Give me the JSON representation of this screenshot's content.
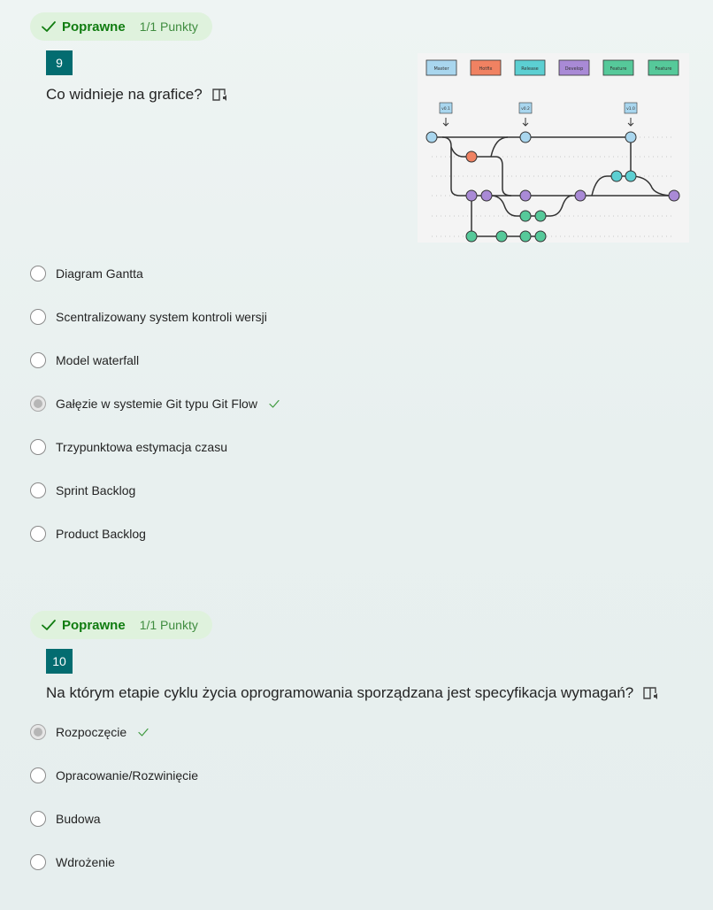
{
  "q9": {
    "status": "Poprawne",
    "points": "1/1 Punkty",
    "number": "9",
    "question": "Co widnieje na grafice?",
    "graphic": {
      "legend": [
        "Master",
        "Hotfix",
        "Release",
        "Develop",
        "Feature",
        "Feature"
      ],
      "tags": [
        "v0.1",
        "v0.2",
        "v1.0"
      ]
    },
    "options": [
      {
        "label": "Diagram Gantta",
        "selected": false
      },
      {
        "label": "Scentralizowany system kontroli wersji",
        "selected": false
      },
      {
        "label": "Model waterfall",
        "selected": false
      },
      {
        "label": "Gałęzie w systemie Git typu Git Flow",
        "selected": true
      },
      {
        "label": "Trzypunktowa estymacja czasu",
        "selected": false
      },
      {
        "label": "Sprint Backlog",
        "selected": false
      },
      {
        "label": "Product Backlog",
        "selected": false
      }
    ]
  },
  "q10": {
    "status": "Poprawne",
    "points": "1/1 Punkty",
    "number": "10",
    "question": "Na którym etapie cyklu życia oprogramowania sporządzana jest specyfikacja wymagań?",
    "options": [
      {
        "label": "Rozpoczęcie",
        "selected": true
      },
      {
        "label": "Opracowanie/Rozwinięcie",
        "selected": false
      },
      {
        "label": "Budowa",
        "selected": false
      },
      {
        "label": "Wdrożenie",
        "selected": false
      }
    ]
  },
  "colors": {
    "accent": "#036c70",
    "correct": "#107c10",
    "badge_bg": "#dff2dd",
    "master": "#a9d6ee",
    "hotfix": "#f08262",
    "release": "#5ccfd2",
    "develop": "#a98ad6",
    "feature": "#56c99a"
  }
}
